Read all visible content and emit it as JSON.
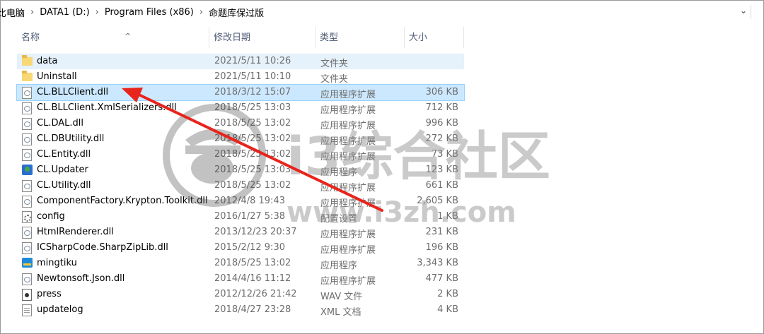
{
  "address": {
    "crumbs": [
      "比电脑",
      "DATA1 (D:)",
      "Program Files (x86)",
      "命题库保过版"
    ],
    "separator": "›",
    "dropdown_glyph": "⌄"
  },
  "columns": {
    "name": "名称",
    "date": "修改日期",
    "type": "类型",
    "size": "大小"
  },
  "files": [
    {
      "name": "data",
      "date": "2021/5/11 10:26",
      "type": "文件夹",
      "size": "",
      "icon": "folder-icon"
    },
    {
      "name": "Uninstall",
      "date": "2021/5/11 10:10",
      "type": "文件夹",
      "size": "",
      "icon": "folder-icon"
    },
    {
      "name": "CL.BLLClient.dll",
      "date": "2018/3/12 15:07",
      "type": "应用程序扩展",
      "size": "306 KB",
      "icon": "dll-file-icon"
    },
    {
      "name": "CL.BLLClient.XmlSerializers.dll",
      "date": "2018/5/25 13:03",
      "type": "应用程序扩展",
      "size": "712 KB",
      "icon": "dll-file-icon"
    },
    {
      "name": "CL.DAL.dll",
      "date": "2018/5/25 13:02",
      "type": "应用程序扩展",
      "size": "996 KB",
      "icon": "dll-file-icon"
    },
    {
      "name": "CL.DBUtility.dll",
      "date": "2018/5/25 13:02",
      "type": "应用程序扩展",
      "size": "272 KB",
      "icon": "dll-file-icon"
    },
    {
      "name": "CL.Entity.dll",
      "date": "2018/5/25 13:02",
      "type": "应用程序扩展",
      "size": "73 KB",
      "icon": "dll-file-icon"
    },
    {
      "name": "CL.Updater",
      "date": "2018/5/25 13:03",
      "type": "应用程序",
      "size": "123 KB",
      "icon": "updater-app-icon"
    },
    {
      "name": "CL.Utility.dll",
      "date": "2018/5/25 13:02",
      "type": "应用程序扩展",
      "size": "661 KB",
      "icon": "dll-file-icon"
    },
    {
      "name": "ComponentFactory.Krypton.Toolkit.dll",
      "date": "2012/4/8 19:43",
      "type": "应用程序扩展",
      "size": "2,605 KB",
      "icon": "dll-file-icon"
    },
    {
      "name": "config",
      "date": "2016/1/27 5:38",
      "type": "配置设置",
      "size": "1 KB",
      "icon": "config-file-icon"
    },
    {
      "name": "HtmlRenderer.dll",
      "date": "2013/12/23 20:37",
      "type": "应用程序扩展",
      "size": "231 KB",
      "icon": "dll-file-icon"
    },
    {
      "name": "ICSharpCode.SharpZipLib.dll",
      "date": "2015/2/12 9:30",
      "type": "应用程序扩展",
      "size": "196 KB",
      "icon": "dll-file-icon"
    },
    {
      "name": "mingtiku",
      "date": "2018/5/25 13:02",
      "type": "应用程序",
      "size": "3,343 KB",
      "icon": "mingtiku-app-icon"
    },
    {
      "name": "Newtonsoft.Json.dll",
      "date": "2014/4/16 11:12",
      "type": "应用程序扩展",
      "size": "477 KB",
      "icon": "dll-file-icon"
    },
    {
      "name": "press",
      "date": "2012/12/26 21:42",
      "type": "WAV 文件",
      "size": "2 KB",
      "icon": "wav-file-icon"
    },
    {
      "name": "updatelog",
      "date": "2018/4/27 23:28",
      "type": "XML 文档",
      "size": "4 KB",
      "icon": "xml-doc-icon"
    }
  ],
  "watermark": {
    "text_cn": "i3综合社区",
    "text_url": "www.i3zh.com"
  },
  "colors": {
    "selection": "#cce8ff",
    "hover": "#e5f1fb",
    "arrow": "#e8241c",
    "header_text": "#4d5b77"
  }
}
